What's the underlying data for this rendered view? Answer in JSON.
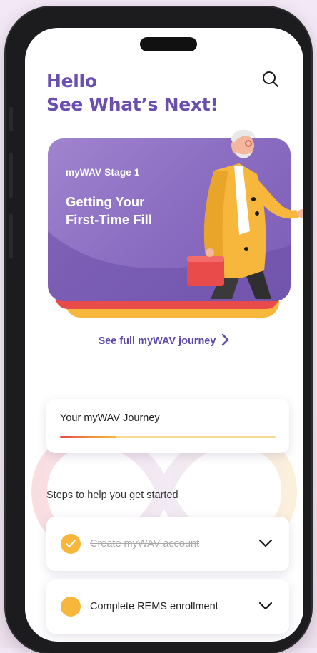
{
  "header": {
    "greeting_line1": "Hello",
    "greeting_line2": "See What’s Next!",
    "search_icon": "search-icon"
  },
  "hero": {
    "stage_label": "myWAV Stage 1",
    "title": "Getting Your First-Time Fill"
  },
  "journey_link": {
    "label": "See full myWAV journey",
    "icon": "chevron-right-icon"
  },
  "journey_card": {
    "title": "Your myWAV Journey",
    "progress": 0.26
  },
  "steps_heading": "Steps to help you get started",
  "steps": [
    {
      "label": "Create myWAV account",
      "completed": true
    },
    {
      "label": "Complete REMS enrollment",
      "completed": false
    }
  ],
  "colors": {
    "brand_purple": "#6a4fb0",
    "hero_purple": "#8c6fc2",
    "accent_yellow": "#f6b73c",
    "accent_red": "#e94a4a",
    "link_purple": "#5f4aa6"
  }
}
